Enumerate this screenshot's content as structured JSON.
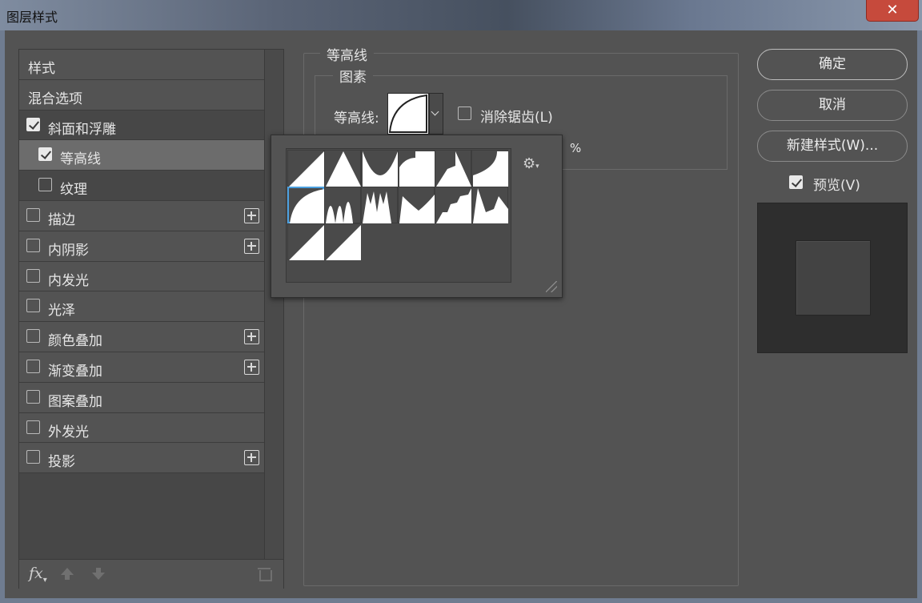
{
  "window": {
    "title": "图层样式",
    "close": "✕"
  },
  "left_panel": {
    "items": [
      {
        "label": "样式",
        "checkbox": null,
        "checked": false,
        "plus": false,
        "indent": 0
      },
      {
        "label": "混合选项",
        "checkbox": null,
        "checked": false,
        "plus": false,
        "indent": 0
      },
      {
        "label": "斜面和浮雕",
        "checkbox": true,
        "checked": true,
        "plus": false,
        "indent": 0
      },
      {
        "label": "等高线",
        "checkbox": true,
        "checked": true,
        "plus": false,
        "indent": 1,
        "selected": true
      },
      {
        "label": "纹理",
        "checkbox": true,
        "checked": false,
        "plus": false,
        "indent": 1
      },
      {
        "label": "描边",
        "checkbox": true,
        "checked": false,
        "plus": true,
        "indent": 0
      },
      {
        "label": "内阴影",
        "checkbox": true,
        "checked": false,
        "plus": true,
        "indent": 0
      },
      {
        "label": "内发光",
        "checkbox": true,
        "checked": false,
        "plus": false,
        "indent": 0
      },
      {
        "label": "光泽",
        "checkbox": true,
        "checked": false,
        "plus": false,
        "indent": 0
      },
      {
        "label": "颜色叠加",
        "checkbox": true,
        "checked": false,
        "plus": true,
        "indent": 0
      },
      {
        "label": "渐变叠加",
        "checkbox": true,
        "checked": false,
        "plus": true,
        "indent": 0
      },
      {
        "label": "图案叠加",
        "checkbox": true,
        "checked": false,
        "plus": false,
        "indent": 0
      },
      {
        "label": "外发光",
        "checkbox": true,
        "checked": false,
        "plus": false,
        "indent": 0
      },
      {
        "label": "投影",
        "checkbox": true,
        "checked": false,
        "plus": true,
        "indent": 0
      }
    ],
    "footer": {
      "fx": "fx"
    }
  },
  "main": {
    "section_title": "等高线",
    "group_title": "图素",
    "contour_label": "等高线:",
    "antialias_label": "消除锯齿(L)",
    "antialias_checked": false,
    "range_unit": "%"
  },
  "picker": {
    "contours": [
      "linear",
      "cone",
      "cone-inverted",
      "cove-deep",
      "cove-shallow",
      "gaussian",
      "half-round",
      "ring",
      "ring-double",
      "rolling-slope",
      "rounded-steps",
      "sawtooth",
      "linear-inverse",
      "linear-2"
    ],
    "selected_index": 6
  },
  "buttons": {
    "ok": "确定",
    "cancel": "取消",
    "new_style": "新建样式(W)...",
    "preview": "预览(V)",
    "preview_checked": true
  }
}
